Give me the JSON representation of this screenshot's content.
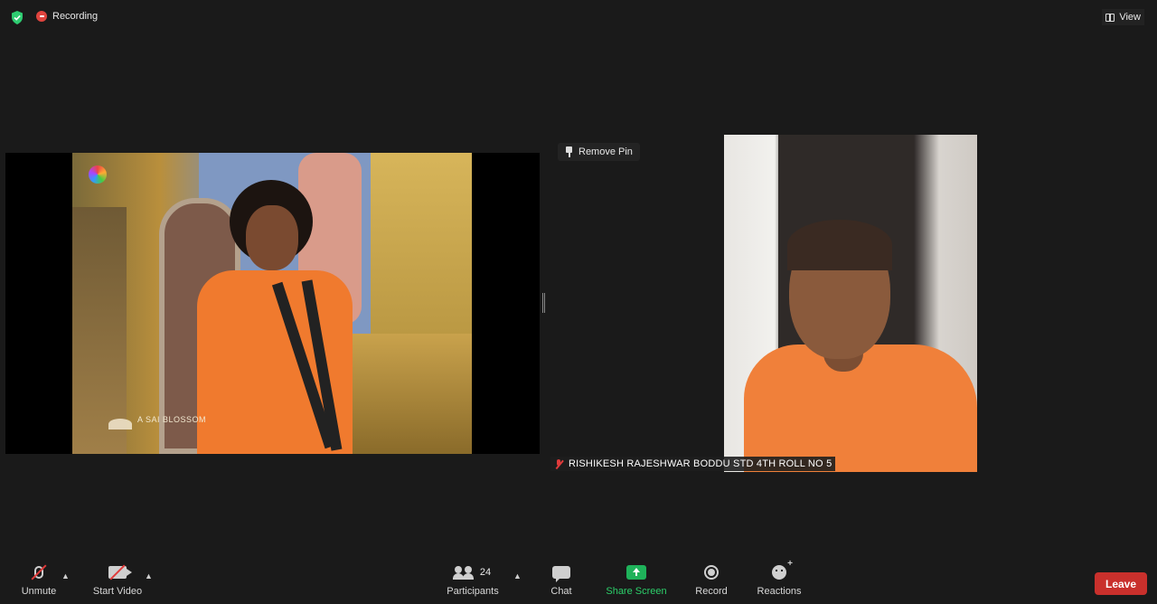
{
  "topbar": {
    "recording_label": "Recording",
    "view_label": "View",
    "shield_color": "#2ecc71",
    "recording_color": "#e0443e"
  },
  "shared_screen": {
    "watermark_text": "A SAI BLOSSOM"
  },
  "pin": {
    "label": "Remove Pin"
  },
  "participant": {
    "name": "RISHIKESH RAJESHWAR BODDU STD 4TH ROLL NO 5",
    "muted": true
  },
  "toolbar": {
    "unmute_label": "Unmute",
    "start_video_label": "Start Video",
    "participants_label": "Participants",
    "participants_count": "24",
    "chat_label": "Chat",
    "share_screen_label": "Share Screen",
    "record_label": "Record",
    "reactions_label": "Reactions",
    "leave_label": "Leave",
    "share_color": "#1fb25a",
    "leave_color": "#c9302c"
  }
}
